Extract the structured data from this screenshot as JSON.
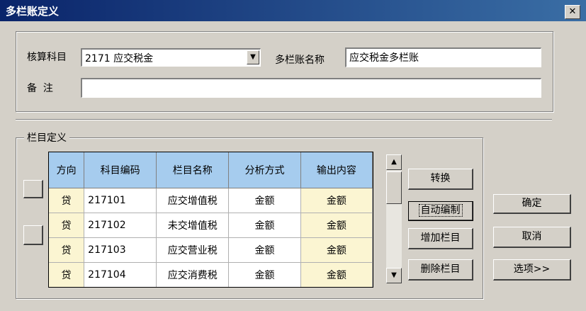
{
  "window": {
    "title": "多栏账定义",
    "close_glyph": "✕"
  },
  "header": {
    "subject_label": "核算科目",
    "subject_value": "2171 应交税金",
    "ledger_name_label": "多栏账名称",
    "ledger_name_value": "应交税金多栏账",
    "remark_label": "备  注",
    "remark_value": ""
  },
  "columns_group": {
    "title": "栏目定义",
    "headers": [
      "方向",
      "科目编码",
      "栏目名称",
      "分析方式",
      "输出内容"
    ],
    "rows": [
      [
        "贷",
        "217101",
        "应交增值税",
        "金额",
        "金额"
      ],
      [
        "贷",
        "217102",
        "未交增值税",
        "金额",
        "金额"
      ],
      [
        "贷",
        "217103",
        "应交营业税",
        "金额",
        "金额"
      ],
      [
        "贷",
        "217104",
        "应交消费税",
        "金额",
        "金额"
      ]
    ]
  },
  "buttons": {
    "convert": "转换",
    "auto_compile": "自动编制",
    "add_column": "增加栏目",
    "delete_column": "删除栏目",
    "ok": "确定",
    "cancel": "取消",
    "options": "选项>>"
  },
  "colors": {
    "header_bg": "#a6ccee",
    "cell_yellow": "#fbf5d2",
    "titlebar": "#0a246a"
  }
}
